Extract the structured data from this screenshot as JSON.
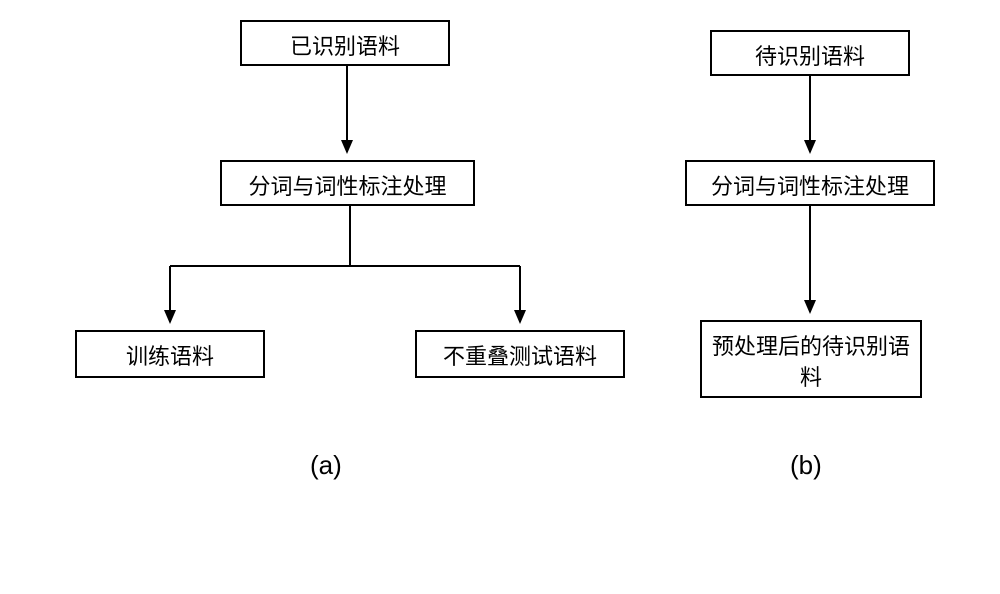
{
  "flowchart_a": {
    "box1": "已识别语料",
    "box2": "分词与词性标注处理",
    "box3": "训练语料",
    "box4": "不重叠测试语料",
    "label": "(a)"
  },
  "flowchart_b": {
    "box1": "待识别语料",
    "box2": "分词与词性标注处理",
    "box3": "预处理后的待识别语料",
    "label": "(b)"
  },
  "chart_data": [
    {
      "type": "flowchart",
      "id": "a",
      "nodes": [
        {
          "id": "a1",
          "label": "已识别语料"
        },
        {
          "id": "a2",
          "label": "分词与词性标注处理"
        },
        {
          "id": "a3",
          "label": "训练语料"
        },
        {
          "id": "a4",
          "label": "不重叠测试语料"
        }
      ],
      "edges": [
        {
          "from": "a1",
          "to": "a2"
        },
        {
          "from": "a2",
          "to": "a3"
        },
        {
          "from": "a2",
          "to": "a4"
        }
      ],
      "label": "(a)"
    },
    {
      "type": "flowchart",
      "id": "b",
      "nodes": [
        {
          "id": "b1",
          "label": "待识别语料"
        },
        {
          "id": "b2",
          "label": "分词与词性标注处理"
        },
        {
          "id": "b3",
          "label": "预处理后的待识别语料"
        }
      ],
      "edges": [
        {
          "from": "b1",
          "to": "b2"
        },
        {
          "from": "b2",
          "to": "b3"
        }
      ],
      "label": "(b)"
    }
  ]
}
